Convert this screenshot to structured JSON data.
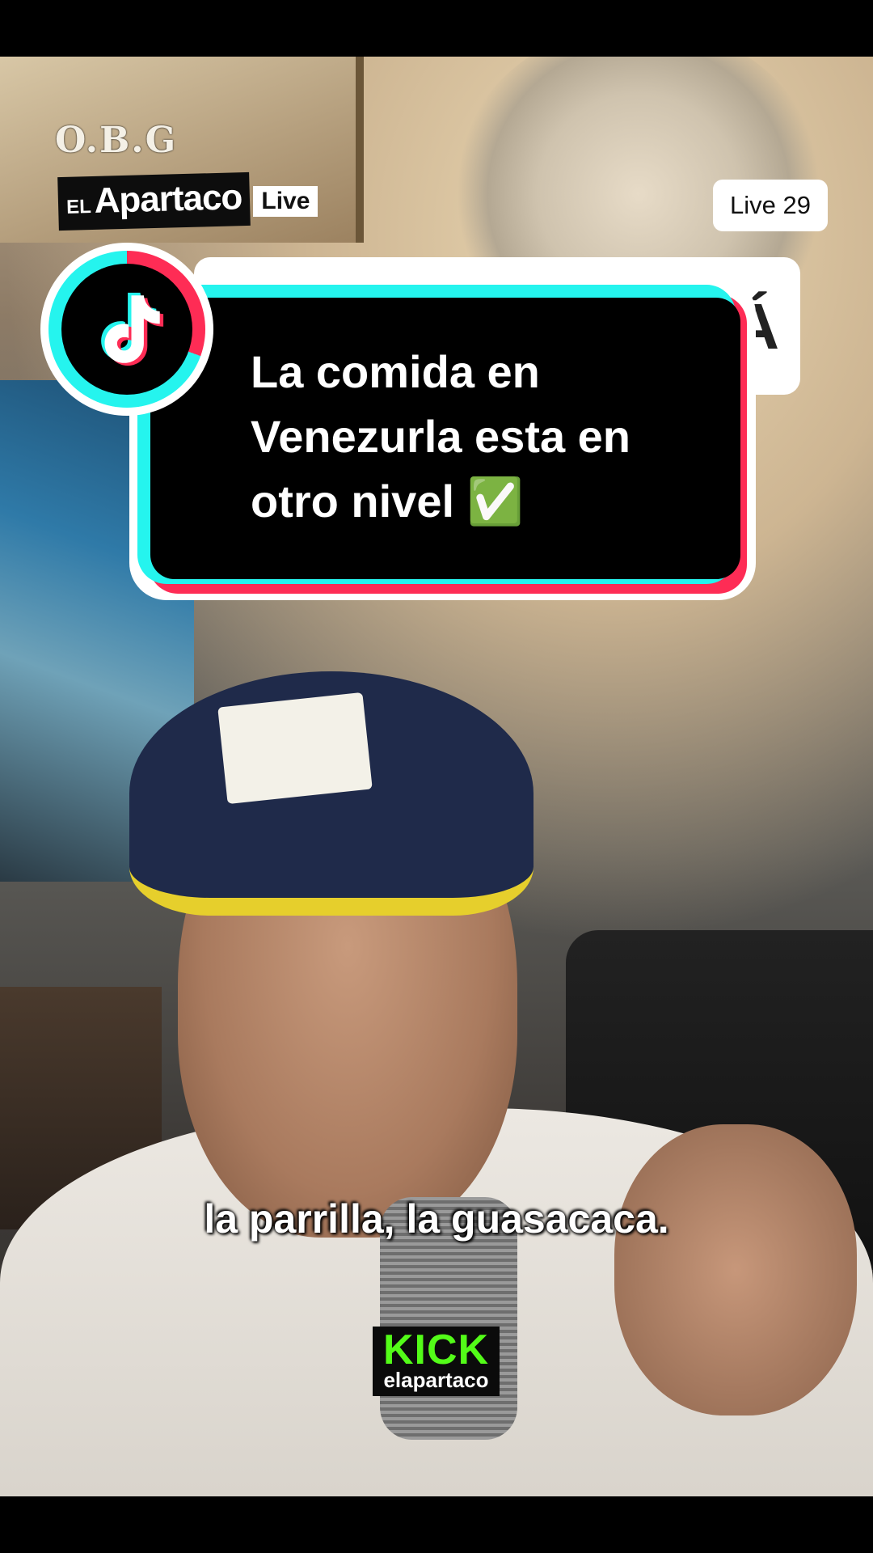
{
  "watermark": {
    "text": "O.B.G"
  },
  "brand": {
    "prefix": "EL",
    "name": "Apartaco",
    "live_label": "Live"
  },
  "badge": {
    "text": "Live 29"
  },
  "background_card": {
    "partial_letter": "Á"
  },
  "callout": {
    "line1": "La comida en",
    "line2": "Venezurla esta en",
    "line3": "otro nivel ✅",
    "icon": "tiktok-logo-icon",
    "colors": {
      "cyan": "#25f4ee",
      "red": "#fe2c55",
      "fill": "#000000"
    }
  },
  "subtitle": {
    "text": "la parrilla, la guasacaca."
  },
  "kick": {
    "logo": "KICK",
    "username": "elapartaco",
    "color": "#53fc18"
  }
}
